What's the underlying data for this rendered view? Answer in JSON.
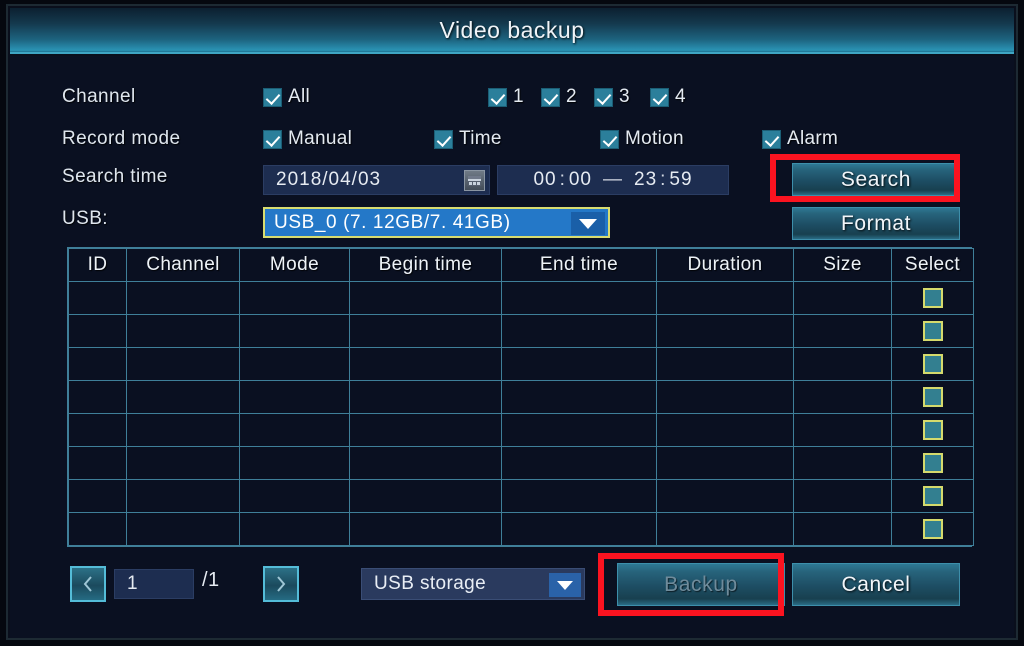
{
  "window": {
    "title": "Video backup"
  },
  "form": {
    "channel": {
      "label": "Channel",
      "all": {
        "label": "All",
        "checked": true
      },
      "items": [
        {
          "label": "1",
          "checked": true
        },
        {
          "label": "2",
          "checked": true
        },
        {
          "label": "3",
          "checked": true
        },
        {
          "label": "4",
          "checked": true
        }
      ]
    },
    "record_mode": {
      "label": "Record mode",
      "items": [
        {
          "label": "Manual",
          "checked": true
        },
        {
          "label": "Time",
          "checked": true
        },
        {
          "label": "Motion",
          "checked": true
        },
        {
          "label": "Alarm",
          "checked": true
        }
      ]
    },
    "search_time": {
      "label": "Search time",
      "date": "2018/04/03",
      "calendar_icon": "calendar-icon",
      "start_hour": "00",
      "start_minute": "00",
      "range_separator": "—",
      "end_hour": "23",
      "end_minute": "59",
      "colon": ":"
    },
    "usb": {
      "label": "USB:",
      "selected": "USB_0  (7. 12GB/7. 41GB)",
      "dropdown_icon": "chevron-down-icon"
    }
  },
  "buttons": {
    "search": "Search",
    "format": "Format",
    "backup": "Backup",
    "cancel": "Cancel"
  },
  "table": {
    "columns": [
      "ID",
      "Channel",
      "Mode",
      "Begin time",
      "End time",
      "Duration",
      "Size",
      "Select"
    ],
    "rows": [
      {
        "id": "",
        "channel": "",
        "mode": "",
        "begin_time": "",
        "end_time": "",
        "duration": "",
        "size": "",
        "selected": false
      },
      {
        "id": "",
        "channel": "",
        "mode": "",
        "begin_time": "",
        "end_time": "",
        "duration": "",
        "size": "",
        "selected": false
      },
      {
        "id": "",
        "channel": "",
        "mode": "",
        "begin_time": "",
        "end_time": "",
        "duration": "",
        "size": "",
        "selected": false
      },
      {
        "id": "",
        "channel": "",
        "mode": "",
        "begin_time": "",
        "end_time": "",
        "duration": "",
        "size": "",
        "selected": false
      },
      {
        "id": "",
        "channel": "",
        "mode": "",
        "begin_time": "",
        "end_time": "",
        "duration": "",
        "size": "",
        "selected": false
      },
      {
        "id": "",
        "channel": "",
        "mode": "",
        "begin_time": "",
        "end_time": "",
        "duration": "",
        "size": "",
        "selected": false
      },
      {
        "id": "",
        "channel": "",
        "mode": "",
        "begin_time": "",
        "end_time": "",
        "duration": "",
        "size": "",
        "selected": false
      },
      {
        "id": "",
        "channel": "",
        "mode": "",
        "begin_time": "",
        "end_time": "",
        "duration": "",
        "size": "",
        "selected": false
      }
    ]
  },
  "pager": {
    "prev_icon": "chevron-left-icon",
    "next_icon": "chevron-right-icon",
    "current_page": "1",
    "total_pages": "/1"
  },
  "storage": {
    "selected": "USB storage",
    "dropdown_icon": "chevron-down-icon"
  },
  "annotations": [
    {
      "target": "search-button",
      "color": "#fb1320"
    },
    {
      "target": "backup-button",
      "color": "#fb1320"
    }
  ],
  "colors": {
    "accent": "#3fa6c4",
    "highlight": "#2478c8",
    "focus_border": "#d8dc70",
    "grid_line": "#3f7f99",
    "annotation": "#fb1320",
    "background": "#0a1021"
  }
}
